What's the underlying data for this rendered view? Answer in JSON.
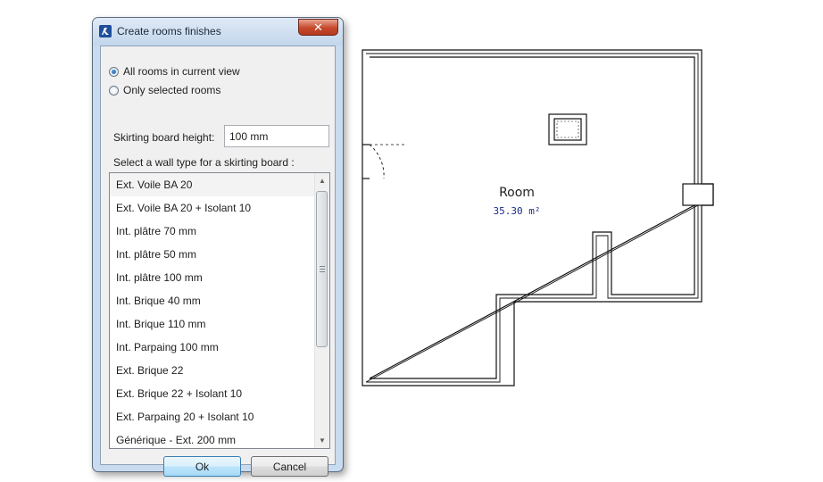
{
  "dialog": {
    "title": "Create rooms finishes",
    "close_symbol": "✕",
    "scope_options": [
      {
        "label": "All rooms in current view",
        "checked": true
      },
      {
        "label": "Only selected rooms",
        "checked": false
      }
    ],
    "skirting_height_label": "Skirting board height:",
    "skirting_height_value": "100 mm",
    "wall_type_label": "Select a wall type for a skirting board :",
    "wall_types": [
      "Ext. Voile BA 20",
      "Ext. Voile BA 20 + Isolant 10",
      "Int. plâtre 70 mm",
      "Int. plâtre 50 mm",
      "Int. plâtre 100 mm",
      "Int. Brique 40 mm",
      "Int. Brique 110 mm",
      "Int. Parpaing 100 mm",
      "Ext. Brique 22",
      "Ext. Brique 22 + Isolant 10",
      "Ext. Parpaing 20 + Isolant 10",
      "Générique - Ext. 200 mm"
    ],
    "ok_label": "Ok",
    "cancel_label": "Cancel"
  },
  "plan": {
    "room_name": "Room",
    "room_area": "35.30 m²"
  }
}
